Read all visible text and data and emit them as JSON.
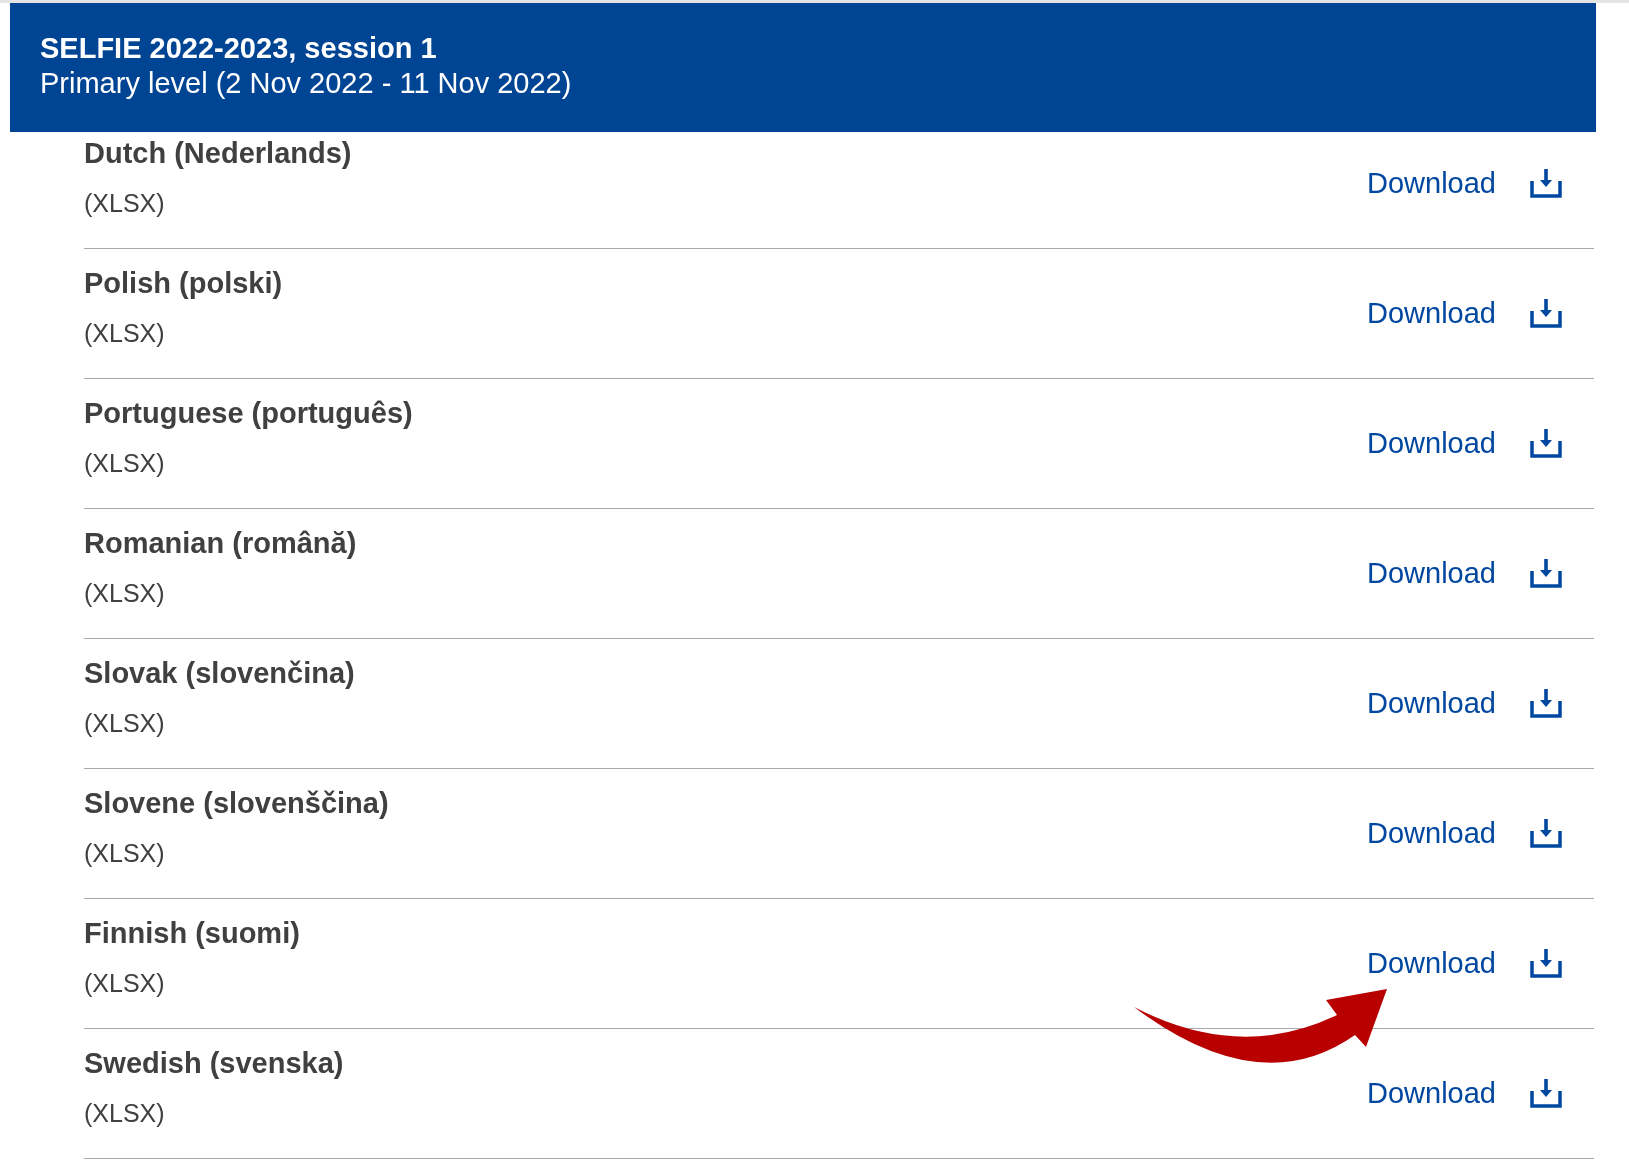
{
  "header": {
    "title": "SELFIE 2022-2023, session 1",
    "subtitle": "Primary level (2 Nov 2022 - 11 Nov 2022)"
  },
  "files": [
    {
      "language": "Dutch (Nederlands)",
      "format": "(XLSX)",
      "link": "Download",
      "arrow": false
    },
    {
      "language": "Polish (polski)",
      "format": "(XLSX)",
      "link": "Download",
      "arrow": false
    },
    {
      "language": "Portuguese (português)",
      "format": "(XLSX)",
      "link": "Download",
      "arrow": false
    },
    {
      "language": "Romanian (română)",
      "format": "(XLSX)",
      "link": "Download",
      "arrow": false
    },
    {
      "language": "Slovak (slovenčina)",
      "format": "(XLSX)",
      "link": "Download",
      "arrow": false
    },
    {
      "language": "Slovene (slovenščina)",
      "format": "(XLSX)",
      "link": "Download",
      "arrow": false
    },
    {
      "language": "Finnish (suomi)",
      "format": "(XLSX)",
      "link": "Download",
      "arrow": true
    },
    {
      "language": "Swedish (svenska)",
      "format": "(XLSX)",
      "link": "Download",
      "arrow": false
    }
  ]
}
